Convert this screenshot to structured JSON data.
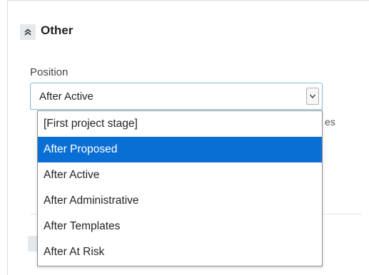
{
  "section": {
    "title": "Other"
  },
  "position_field": {
    "label": "Position",
    "selected_value": "After Active",
    "options": [
      "[First project stage]",
      "After Proposed",
      "After Active",
      "After Administrative",
      "After Templates",
      "After At Risk"
    ],
    "highlighted_index": 1
  },
  "obscured_text_fragment": "es",
  "icons": {
    "collapse": "double-chevron-up-icon",
    "dropdown_arrow": "chevron-down-icon"
  },
  "colors": {
    "highlight": "#0a6fd4",
    "select_border": "#7eb8e6",
    "button_bg": "#e4e9ee"
  }
}
